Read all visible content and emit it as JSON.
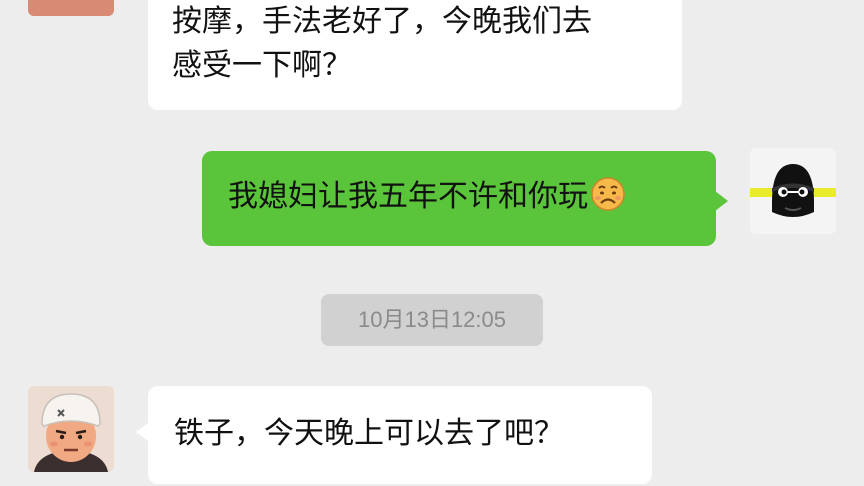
{
  "messages": [
    {
      "sender": "friend",
      "text_line1": "按摩，手法老好了，今晚我们去",
      "text_line2": "感受一下啊？"
    },
    {
      "sender": "me",
      "text": "我媳妇让我五年不许和你玩",
      "emoji": "frowning-face-emoji"
    },
    {
      "sender": "friend",
      "text": "铁子，今天晚上可以去了吧？"
    }
  ],
  "timestamp": "10月13日12:05",
  "colors": {
    "background": "#ededed",
    "outgoing_bubble": "#5ac53a",
    "incoming_bubble": "#ffffff",
    "timestamp_bg": "#d1d1d1",
    "timestamp_text": "#8a8a8a"
  }
}
